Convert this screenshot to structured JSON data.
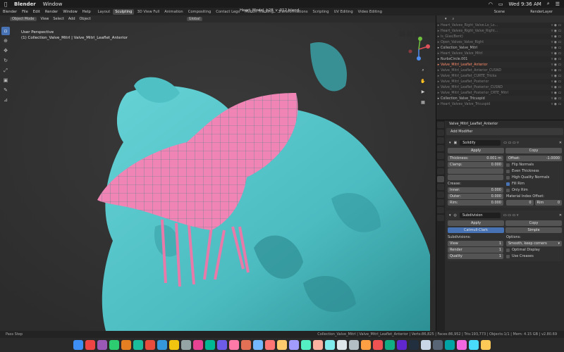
{
  "mac_menu": {
    "app": "Blender",
    "window": "Window",
    "clock": "Wed 9:36 AM"
  },
  "blender_menu": [
    "Blender",
    "File",
    "Edit",
    "Render",
    "Window",
    "Help"
  ],
  "workspace_tabs": [
    {
      "label": "Layout",
      "active": false
    },
    {
      "label": "Sculpting",
      "active": true
    },
    {
      "label": "3D View Full",
      "active": false
    },
    {
      "label": "Animation",
      "active": false
    },
    {
      "label": "Compositing",
      "active": false
    },
    {
      "label": "Contact Legs",
      "active": false
    },
    {
      "label": "Motion Tracking",
      "active": false
    },
    {
      "label": "Transformations",
      "active": false
    },
    {
      "label": "Scripting",
      "active": false
    },
    {
      "label": "UV Editing",
      "active": false
    },
    {
      "label": "Video Editing",
      "active": false
    }
  ],
  "file_title": "Heart_Model_b28_v_012.blend",
  "scene": {
    "label": "Scene",
    "render_layer": "RenderLayer"
  },
  "viewport": {
    "mode": "Object Mode",
    "menus": [
      "View",
      "Select",
      "Add",
      "Object"
    ],
    "orientation": "Global",
    "perspective": "User Perspective",
    "collection_line": "(1) Collection_Valve_Mitrl | Valve_Mitrl_Leaflet_Anterior"
  },
  "outliner": [
    {
      "label": "Heart_Valves_Right_Valve.Lo_Lo...",
      "state": "dim"
    },
    {
      "label": "Heart_Valves_Right_Valve_Right...",
      "state": "dim"
    },
    {
      "label": "Is_Glas(Bent)",
      "state": "dim"
    },
    {
      "label": "Open_Valves_Valve_Right",
      "state": "dim"
    },
    {
      "label": "Collection_Valve_Mitrl",
      "state": "normal"
    },
    {
      "label": "Heart_Valves_Valve_Mitrl",
      "state": "dim"
    },
    {
      "label": "NurbsCircle.001",
      "state": "normal"
    },
    {
      "label": "Valve_Mitrl_Leaflet_Anterior",
      "state": "sel"
    },
    {
      "label": "Valve_Mitrl_Leaflet_Anterior_CUSND",
      "state": "dim"
    },
    {
      "label": "Valve_Mitrl_Leaflet_CURTE_Tricka",
      "state": "dim"
    },
    {
      "label": "Valve_Mitrl_Leaflet_Posterior",
      "state": "dim"
    },
    {
      "label": "Valve_Mitrl_Leaflet_Posterior_CUSND",
      "state": "dim"
    },
    {
      "label": "Valve_Mitrl_Leaflet_Posterior_CRTE_Mitrl",
      "state": "dim"
    },
    {
      "label": "Collection_Valve_Tricuspid",
      "state": "normal"
    },
    {
      "label": "Heart_Valves_Valve_Tricuspid",
      "state": "dim"
    }
  ],
  "properties": {
    "object_name": "Valve_Mitrl_Leaflet_Anterior",
    "add_modifier": "Add Modifier",
    "solidify": {
      "name": "Solidify",
      "apply": "Apply",
      "copy": "Copy",
      "thickness_label": "Thickness:",
      "thickness": "0.001 m",
      "offset_label": "Offset:",
      "offset": "-1.0000",
      "clamp_label": "Clamp:",
      "clamp": "0.000",
      "flip_normals": "Flip Normals",
      "even_thickness": "Even Thickness",
      "high_quality": "High Quality Normals",
      "fill_rim": "Fill Rim",
      "only_rim": "Only Rim",
      "crease_label": "Crease:",
      "inner_label": "Inner:",
      "inner": "0.000",
      "outer_label": "Outer:",
      "outer": "0.000",
      "rim_label": "Rim:",
      "rim": "0.000",
      "mat_index_label": "Material Index Offset:",
      "mat_index": "0",
      "mat_rim_label": "Rim",
      "mat_rim": "0"
    },
    "subdivision": {
      "name": "Subdivision",
      "apply": "Apply",
      "copy": "Copy",
      "catmull": "Catmull-Clark",
      "simple": "Simple",
      "subdivisions_label": "Subdivisions:",
      "options_label": "Options:",
      "view_label": "View",
      "view": "1",
      "render_label": "Render",
      "render": "1",
      "quality_label": "Quality",
      "quality": "1",
      "uv_smooth": "Smooth, keep corners",
      "optimal_display": "Optimal Display",
      "use_creases": "Use Creases"
    }
  },
  "status": {
    "left": "Pass Step",
    "right": "Collection_Valve_Mitrl | Valve_Mitrl_Leaflet_Anterior | Verts:86,825 | Faces:86,952 | Tris:193,773 | Objects:1/1 | Mem: 4.15 GB | v2.80.69"
  },
  "dock_colors": [
    "#3d8ff5",
    "#e44",
    "#9b59b6",
    "#2ecc71",
    "#e67e22",
    "#1abc9c",
    "#e74c3c",
    "#3498db",
    "#f1c40f",
    "#95a5a6",
    "#e84393",
    "#00b894",
    "#6c5ce7",
    "#fd79a8",
    "#e17055",
    "#74b9ff",
    "#ff7675",
    "#fdcb6e",
    "#a29bfe",
    "#55efc4",
    "#fab1a0",
    "#81ecec",
    "#dfe6e9",
    "#b2bec3",
    "#ff9f43",
    "#ee5253",
    "#10ac84",
    "#5f27cd",
    "#222f3e",
    "#c8d6e5",
    "#576574",
    "#01a3a4",
    "#f368e0",
    "#48dbfb",
    "#feca57"
  ],
  "colors": {
    "accent": "#4772b3",
    "heart": "#4fc4c8",
    "leaflet": "#f07fb0",
    "selected": "#ff8c6a"
  }
}
